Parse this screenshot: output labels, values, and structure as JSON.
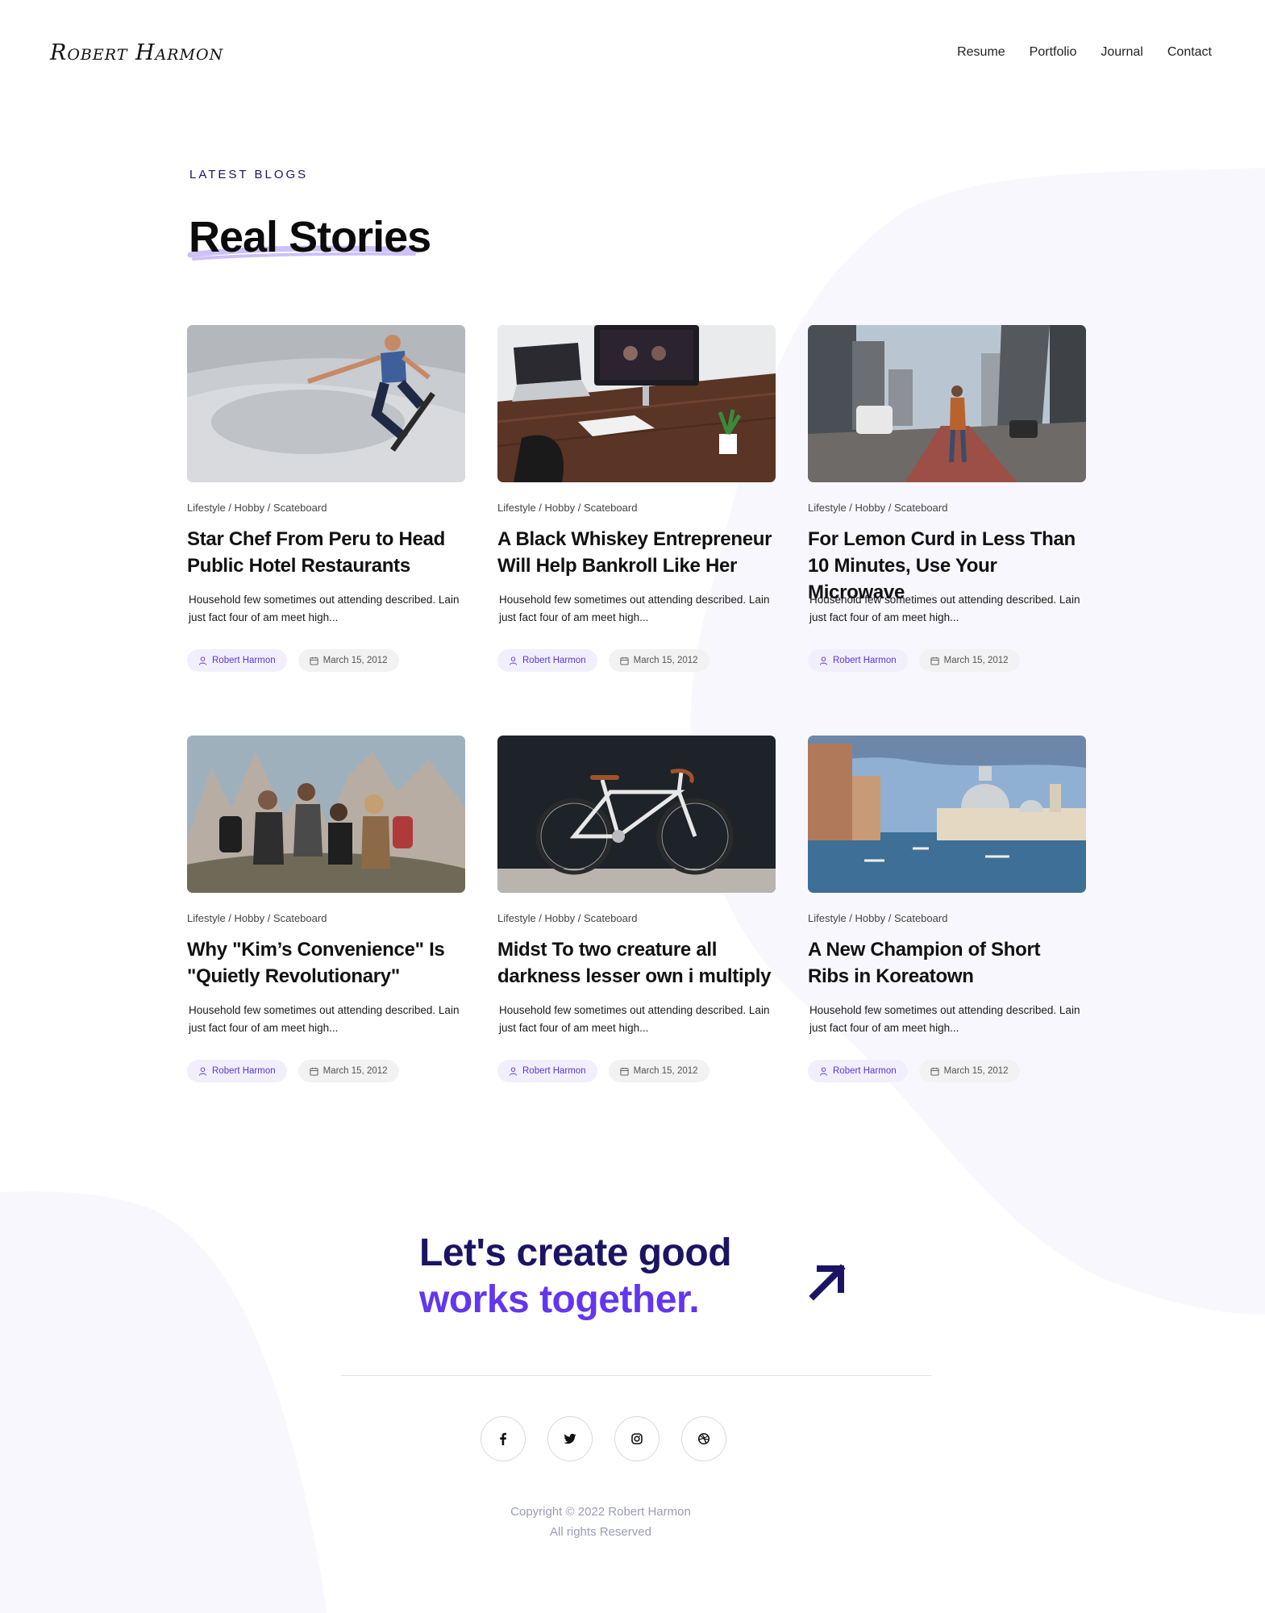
{
  "header": {
    "logo": "Robert Harmon",
    "nav": [
      "Resume",
      "Portfolio",
      "Journal",
      "Contact"
    ]
  },
  "blog": {
    "kicker": "LATEST BLOGS",
    "title": "Real Stories",
    "posts": [
      {
        "image": "skateboarder in concrete skatepark",
        "category": "Lifestyle / Hobby / Scateboard",
        "title": "Star Chef From Peru to Head Public Hotel Restaurants",
        "excerpt": "Household few sometimes out attending described. Lain just fact four of am meet high...",
        "author": "Robert Harmon",
        "date": "March 15, 2012"
      },
      {
        "image": "desk with laptop and monitor",
        "category": "Lifestyle / Hobby / Scateboard",
        "title": "A Black Whiskey Entrepreneur Will Help Bankroll Like Her",
        "excerpt": "Household few sometimes out attending described. Lain just fact four of am meet high...",
        "author": "Robert Harmon",
        "date": "March 15, 2012"
      },
      {
        "image": "woman standing on city street",
        "category": "Lifestyle / Hobby / Scateboard",
        "title": "For Lemon Curd in Less Than 10 Minutes, Use Your Microwave",
        "excerpt": "Household few sometimes out attending described. Lain just fact four of am meet high...",
        "author": "Robert Harmon",
        "date": "March 15, 2012"
      },
      {
        "image": "group of friends hiking in mountains",
        "category": "Lifestyle / Hobby / Scateboard",
        "title": "Why \"Kim’s Convenience\" Is \"Quietly Revolutionary\"",
        "excerpt": "Household few sometimes out attending described. Lain just fact four of am meet high...",
        "author": "Robert Harmon",
        "date": "March 15, 2012"
      },
      {
        "image": "white fixed-gear bicycle against dark wall",
        "category": "Lifestyle / Hobby / Scateboard",
        "title": "Midst To two creature all darkness lesser own i multiply",
        "excerpt": "Household few sometimes out attending described. Lain just fact four of am meet high...",
        "author": "Robert Harmon",
        "date": "March 15, 2012"
      },
      {
        "image": "Venice grand canal with domed basilica",
        "category": "Lifestyle / Hobby / Scateboard",
        "title": "A New Champion of Short Ribs in Koreatown",
        "excerpt": "Household few sometimes out attending described. Lain just fact four of am meet high...",
        "author": "Robert Harmon",
        "date": "March 15, 2012"
      }
    ]
  },
  "cta": {
    "line1": "Let's create good",
    "line2": "works together.",
    "arrow_icon": "arrow-up-right-icon"
  },
  "socials": [
    {
      "icon": "facebook-icon"
    },
    {
      "icon": "twitter-icon"
    },
    {
      "icon": "instagram-icon"
    },
    {
      "icon": "dribbble-icon"
    }
  ],
  "footer": {
    "copyright": "Copyright © 2022 Robert Harmon",
    "rights": "All rights Reserved"
  },
  "colors": {
    "accent": "#6236f0",
    "navy": "#1b1464",
    "blob": "#f8f7fe"
  }
}
